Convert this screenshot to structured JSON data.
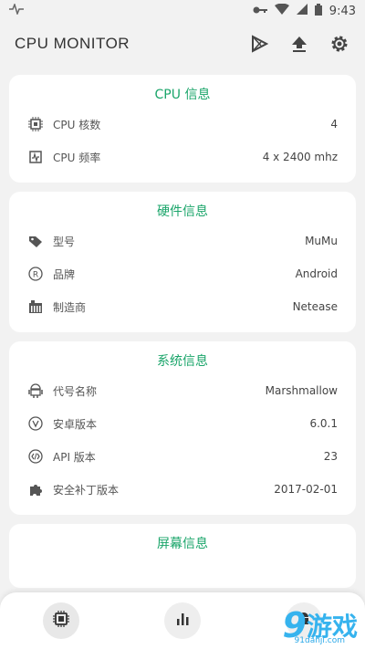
{
  "status": {
    "time": "9:43"
  },
  "app": {
    "title": "CPU MONITOR"
  },
  "cards": {
    "cpu": {
      "title": "CPU 信息",
      "rows": [
        {
          "label": "CPU 核数",
          "value": "4"
        },
        {
          "label": "CPU 频率",
          "value": "4 x 2400 mhz"
        }
      ]
    },
    "hardware": {
      "title": "硬件信息",
      "rows": [
        {
          "label": "型号",
          "value": "MuMu"
        },
        {
          "label": "品牌",
          "value": "Android"
        },
        {
          "label": "制造商",
          "value": "Netease"
        }
      ]
    },
    "system": {
      "title": "系统信息",
      "rows": [
        {
          "label": "代号名称",
          "value": "Marshmallow"
        },
        {
          "label": "安卓版本",
          "value": "6.0.1"
        },
        {
          "label": "API 版本",
          "value": "23"
        },
        {
          "label": "安全补丁版本",
          "value": "2017-02-01"
        }
      ]
    },
    "screen": {
      "title": "屏幕信息"
    }
  },
  "watermark": {
    "num": "9",
    "txt": "游戏",
    "small": "91danji.com"
  },
  "colors": {
    "accent": "#1aa56a",
    "background": "#f2f2f2"
  }
}
